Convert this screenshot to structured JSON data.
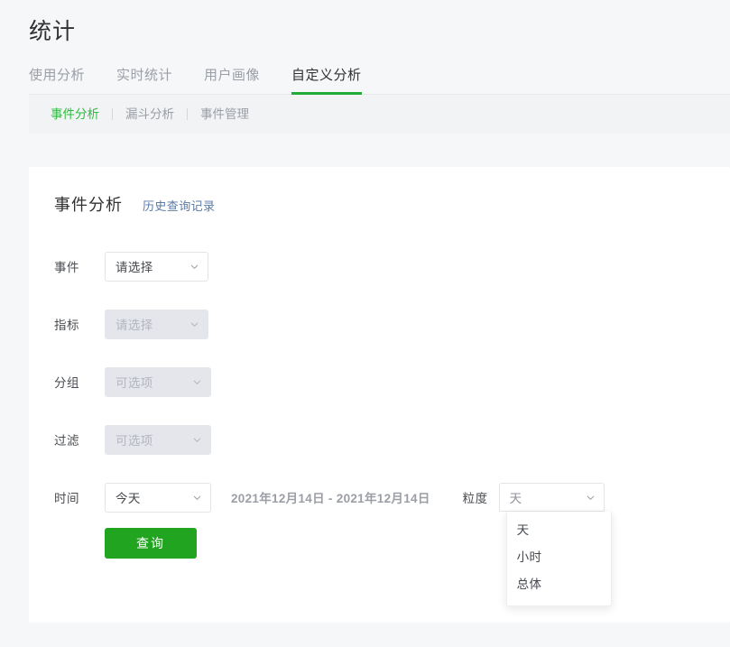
{
  "header": {
    "title": "统计"
  },
  "tabs": [
    {
      "label": "使用分析",
      "active": false
    },
    {
      "label": "实时统计",
      "active": false
    },
    {
      "label": "用户画像",
      "active": false
    },
    {
      "label": "自定义分析",
      "active": true
    }
  ],
  "subnav": [
    {
      "label": "事件分析",
      "active": true
    },
    {
      "label": "漏斗分析",
      "active": false
    },
    {
      "label": "事件管理",
      "active": false
    }
  ],
  "card": {
    "title": "事件分析",
    "history_link": "历史查询记录"
  },
  "form": {
    "rows": [
      {
        "label": "事件",
        "value": "请选择",
        "disabled": false
      },
      {
        "label": "指标",
        "value": "请选择",
        "disabled": true
      },
      {
        "label": "分组",
        "value": "可选项",
        "disabled": true
      },
      {
        "label": "过滤",
        "value": "可选项",
        "disabled": true
      }
    ],
    "time": {
      "label": "时间",
      "value": "今天",
      "date_range": "2021年12月14日 - 2021年12月14日"
    },
    "granularity": {
      "label": "粒度",
      "value": "天",
      "options": [
        "天",
        "小时",
        "总体"
      ]
    },
    "submit_label": "查询"
  },
  "colors": {
    "accent_green": "#22ab38",
    "button_green": "#21a521",
    "subnav_active": "#2fbb3f",
    "link_blue": "#5a7aa8",
    "page_bg": "#f6f7f9",
    "subnav_bg": "#f2f3f5",
    "disabled_bg": "#e4e6eb"
  },
  "icons": {
    "chevron_down": "chevron-down-icon"
  }
}
